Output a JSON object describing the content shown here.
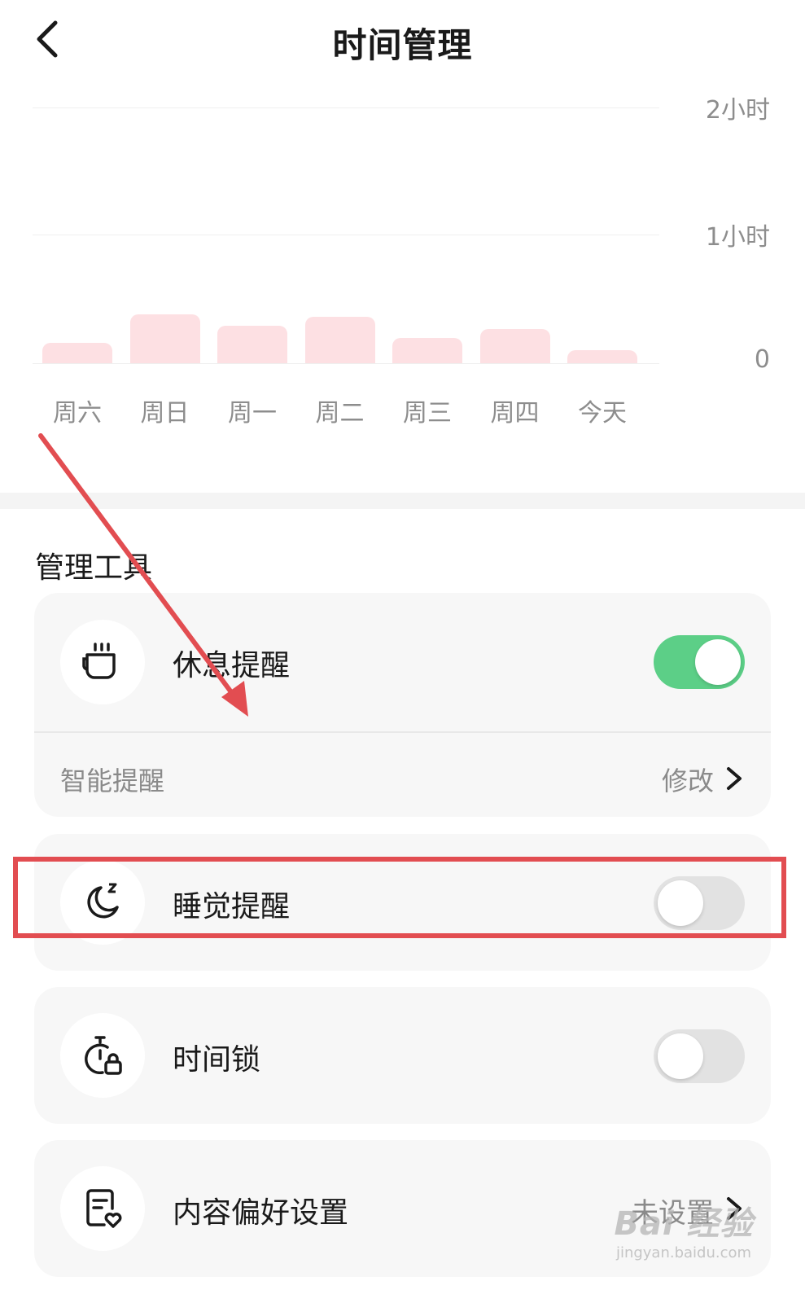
{
  "header": {
    "back_icon": "chevron-left-icon",
    "title": "时间管理"
  },
  "chart_data": {
    "type": "bar",
    "categories": [
      "周六",
      "周日",
      "周一",
      "周二",
      "周三",
      "周四",
      "今天"
    ],
    "values": [
      0.16,
      0.38,
      0.29,
      0.36,
      0.2,
      0.27,
      0.1
    ],
    "unit": "小时",
    "y_tick_labels": [
      "2小时",
      "1小时",
      "0"
    ],
    "ylim": [
      0,
      2
    ],
    "grid": true,
    "bar_color": "#fde0e3"
  },
  "section": {
    "title": "管理工具"
  },
  "tools": {
    "rest_reminder": {
      "icon": "coffee-cup-icon",
      "label": "休息提醒",
      "enabled": true,
      "sub_label": "智能提醒",
      "sub_value": "修改"
    },
    "sleep_reminder": {
      "icon": "moon-sleep-icon",
      "label": "睡觉提醒",
      "enabled": false
    },
    "time_lock": {
      "icon": "timer-lock-icon",
      "label": "时间锁",
      "enabled": false
    },
    "content_preference": {
      "icon": "document-heart-icon",
      "label": "内容偏好设置",
      "value": "未设置"
    }
  },
  "colors": {
    "toggle_on": "#5ccf87",
    "toggle_off": "#e2e2e2",
    "annotation_red": "#e24d51"
  },
  "watermark": {
    "main": "Bai 经验",
    "sub": "jingyan.baidu.com"
  }
}
